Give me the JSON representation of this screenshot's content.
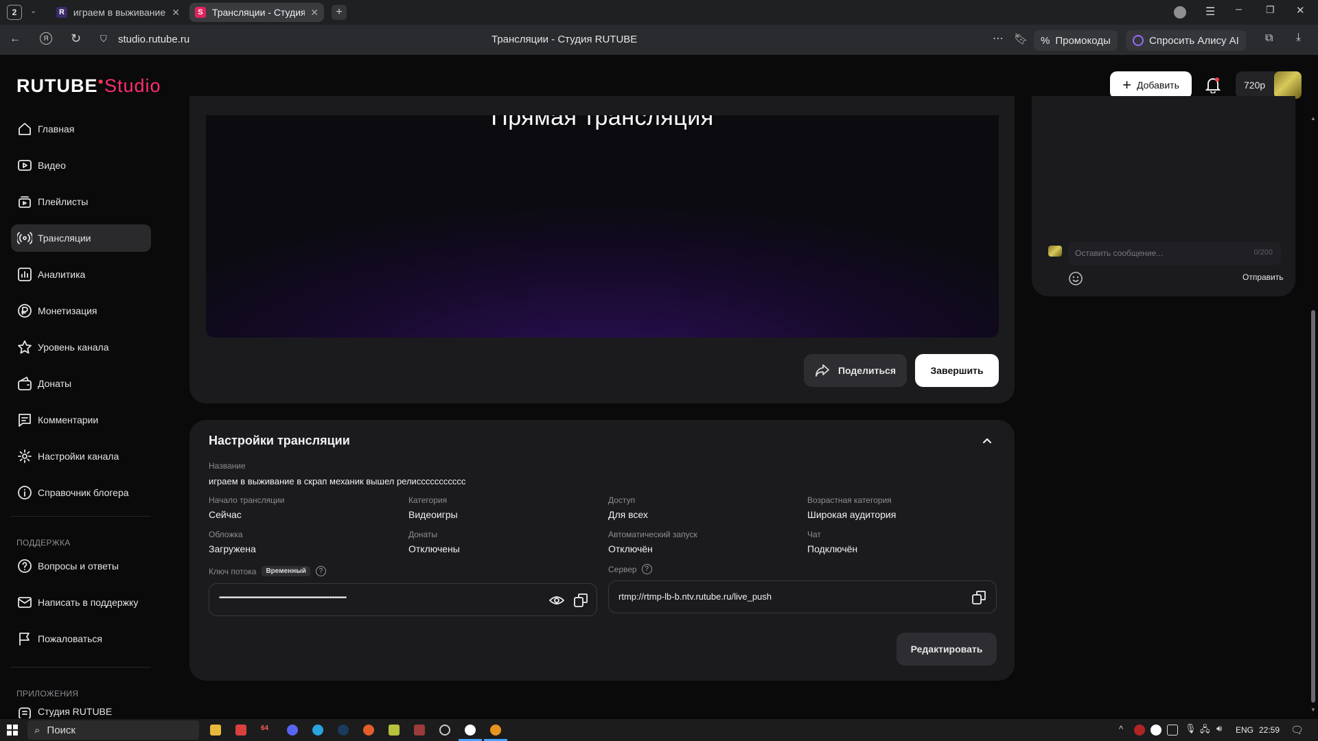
{
  "browser": {
    "tab_count": "2",
    "tabs": [
      {
        "label": "играем в выживание в скрап механик",
        "fav": "R"
      },
      {
        "label": "Трансляции - Студия RUTUBE",
        "fav": "S"
      }
    ],
    "url": "studio.rutube.ru",
    "page_title": "Трансляции - Студия RUTUBE",
    "promo_label": "Промокоды",
    "alice_label": "Спросить Алису AI"
  },
  "header": {
    "logo_main": "RUTUBE",
    "logo_sub": "Studio",
    "add_label": "Добавить",
    "quality": "720p"
  },
  "sidebar": {
    "items": [
      {
        "label": "Главная",
        "icon": "home-icon"
      },
      {
        "label": "Видео",
        "icon": "video-icon"
      },
      {
        "label": "Плейлисты",
        "icon": "playlist-icon"
      },
      {
        "label": "Трансляции",
        "icon": "broadcast-icon"
      },
      {
        "label": "Аналитика",
        "icon": "analytics-icon"
      },
      {
        "label": "Монетизация",
        "icon": "ruble-icon"
      },
      {
        "label": "Уровень канала",
        "icon": "star-icon"
      },
      {
        "label": "Донаты",
        "icon": "donate-icon"
      },
      {
        "label": "Комментарии",
        "icon": "comment-icon"
      },
      {
        "label": "Настройки канала",
        "icon": "gear-icon"
      },
      {
        "label": "Справочник блогера",
        "icon": "info-icon"
      }
    ],
    "support_title": "ПОДДЕРЖКА",
    "support_items": [
      {
        "label": "Вопросы и ответы",
        "icon": "question-icon"
      },
      {
        "label": "Написать в поддержку",
        "icon": "mail-icon"
      },
      {
        "label": "Пожаловаться",
        "icon": "flag-icon"
      }
    ],
    "apps_title": "ПРИЛОЖЕНИЯ",
    "apps_items": [
      {
        "label": "Студия RUTUBE",
        "icon": "studio-app-icon"
      }
    ]
  },
  "player": {
    "overlay_title": "Прямая трансляция",
    "share_label": "Поделиться",
    "finish_label": "Завершить"
  },
  "chat": {
    "placeholder": "Оставить сообщение...",
    "counter": "0/200",
    "send_label": "Отправить"
  },
  "settings": {
    "title": "Настройки трансляции",
    "name_label": "Название",
    "name_value": "играем в выживание в скрап механик вышел релиссссссссссс",
    "fields": [
      {
        "label": "Начало трансляции",
        "value": "Сейчас"
      },
      {
        "label": "Категория",
        "value": "Видеоигры"
      },
      {
        "label": "Доступ",
        "value": "Для всех"
      },
      {
        "label": "Возрастная категория",
        "value": "Широкая аудитория"
      },
      {
        "label": "Обложка",
        "value": "Загружена"
      },
      {
        "label": "Донаты",
        "value": "Отключены"
      },
      {
        "label": "Автоматический запуск",
        "value": "Отключён"
      },
      {
        "label": "Чат",
        "value": "Подключён"
      }
    ],
    "key_label": "Ключ потока",
    "key_badge": "Временный",
    "key_value": "••••••••••••••••••••••••••••••••••••••••••••••••••••••••••••••••••••••••••",
    "server_label": "Сервер",
    "server_value": "rtmp://rtmp-lb-b.ntv.rutube.ru/live_push",
    "edit_label": "Редактировать"
  },
  "taskbar": {
    "search_label": "Поиск",
    "lang": "ENG",
    "time": "22:59",
    "badge_64": "64"
  },
  "colors": {
    "brand_red": "#ff3d4a",
    "studio_pink": "#ff2e6e",
    "active_nav": "#2a2a2d",
    "card_bg": "#1b1b1e"
  }
}
